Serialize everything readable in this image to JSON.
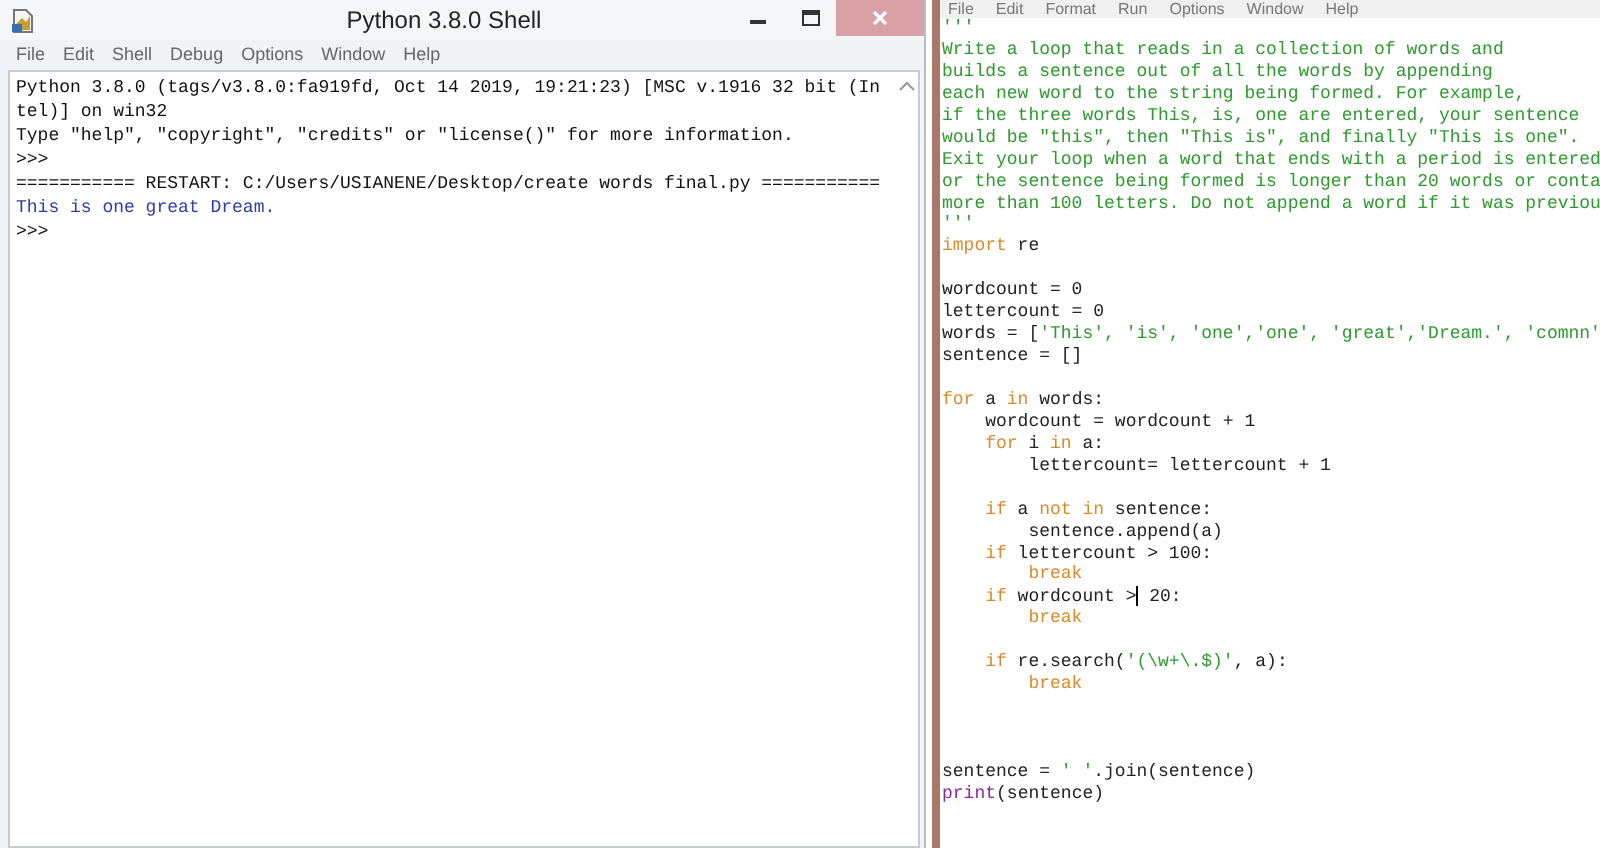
{
  "shell": {
    "title": "Python 3.8.0 Shell",
    "menu": [
      "File",
      "Edit",
      "Shell",
      "Debug",
      "Options",
      "Window",
      "Help"
    ],
    "lines": [
      {
        "kind": "plain",
        "text": "Python 3.8.0 (tags/v3.8.0:fa919fd, Oct 14 2019, 19:21:23) [MSC v.1916 32 bit (In"
      },
      {
        "kind": "plain",
        "text": "tel)] on win32"
      },
      {
        "kind": "plain",
        "text": "Type \"help\", \"copyright\", \"credits\" or \"license()\" for more information."
      },
      {
        "kind": "prompt",
        "text": ">>>"
      },
      {
        "kind": "plain",
        "text": "=========== RESTART: C:/Users/USIANENE/Desktop/create words final.py ==========="
      },
      {
        "kind": "output",
        "text": "This is one great Dream."
      },
      {
        "kind": "prompt",
        "text": ">>>"
      }
    ]
  },
  "editor": {
    "menu": [
      "File",
      "Edit",
      "Format",
      "Run",
      "Options",
      "Window",
      "Help"
    ],
    "lines": [
      {
        "kind": "code",
        "segments": [
          {
            "kind": "string",
            "text": "'''"
          }
        ]
      },
      {
        "kind": "code",
        "segments": [
          {
            "kind": "string",
            "text": "Write a loop that reads in a collection of words and"
          }
        ]
      },
      {
        "kind": "code",
        "segments": [
          {
            "kind": "string",
            "text": "builds a sentence out of all the words by appending"
          }
        ]
      },
      {
        "kind": "code",
        "segments": [
          {
            "kind": "string",
            "text": "each new word to the string being formed. For example,"
          }
        ]
      },
      {
        "kind": "code",
        "segments": [
          {
            "kind": "string",
            "text": "if the three words This, is, one are entered, your sentence"
          }
        ]
      },
      {
        "kind": "code",
        "segments": [
          {
            "kind": "string",
            "text": "would be \"this\", then \"This is\", and finally \"This is one\"."
          }
        ]
      },
      {
        "kind": "code",
        "segments": [
          {
            "kind": "string",
            "text": "Exit your loop when a word that ends with a period is entered"
          }
        ]
      },
      {
        "kind": "code",
        "segments": [
          {
            "kind": "string",
            "text": "or the sentence being formed is longer than 20 words or conta"
          }
        ]
      },
      {
        "kind": "code",
        "segments": [
          {
            "kind": "string",
            "text": "more than 100 letters. Do not append a word if it was previou"
          }
        ]
      },
      {
        "kind": "code",
        "segments": [
          {
            "kind": "string",
            "text": "'''"
          }
        ]
      },
      {
        "kind": "code",
        "segments": [
          {
            "kind": "keyword",
            "text": "import"
          },
          {
            "kind": "plain",
            "text": " re"
          }
        ]
      },
      {
        "kind": "blank"
      },
      {
        "kind": "code",
        "segments": [
          {
            "kind": "plain",
            "text": "wordcount = 0"
          }
        ]
      },
      {
        "kind": "code",
        "segments": [
          {
            "kind": "plain",
            "text": "lettercount = 0"
          }
        ]
      },
      {
        "kind": "code",
        "segments": [
          {
            "kind": "plain",
            "text": "words = ["
          },
          {
            "kind": "string",
            "text": "'This', 'is', 'one','one', 'great','Dream.', 'comnn'"
          }
        ]
      },
      {
        "kind": "code",
        "segments": [
          {
            "kind": "plain",
            "text": "sentence = []"
          }
        ]
      },
      {
        "kind": "blank"
      },
      {
        "kind": "code",
        "segments": [
          {
            "kind": "keyword",
            "text": "for"
          },
          {
            "kind": "plain",
            "text": " a "
          },
          {
            "kind": "keyword",
            "text": "in"
          },
          {
            "kind": "plain",
            "text": " words:"
          }
        ]
      },
      {
        "kind": "code",
        "segments": [
          {
            "kind": "plain",
            "text": "    wordcount = wordcount + 1"
          }
        ]
      },
      {
        "kind": "code",
        "segments": [
          {
            "kind": "keyword",
            "text": "    for"
          },
          {
            "kind": "plain",
            "text": " i "
          },
          {
            "kind": "keyword",
            "text": "in"
          },
          {
            "kind": "plain",
            "text": " a:"
          }
        ]
      },
      {
        "kind": "code",
        "segments": [
          {
            "kind": "plain",
            "text": "        lettercount= lettercount + 1"
          }
        ]
      },
      {
        "kind": "blank"
      },
      {
        "kind": "code",
        "segments": [
          {
            "kind": "keyword",
            "text": "    if"
          },
          {
            "kind": "plain",
            "text": " a "
          },
          {
            "kind": "keyword",
            "text": "not in"
          },
          {
            "kind": "plain",
            "text": " sentence:"
          }
        ]
      },
      {
        "kind": "code",
        "segments": [
          {
            "kind": "plain",
            "text": "        sentence.append(a)"
          }
        ]
      },
      {
        "kind": "code",
        "segments": [
          {
            "kind": "keyword",
            "text": "    if"
          },
          {
            "kind": "plain",
            "text": " lettercount > 100:"
          }
        ]
      },
      {
        "kind": "code",
        "segments": [
          {
            "kind": "keyword",
            "text": "        break"
          }
        ]
      },
      {
        "kind": "code",
        "segments": [
          {
            "kind": "keyword",
            "text": "    if"
          },
          {
            "kind": "plain",
            "text": " wordcount >"
          },
          {
            "kind": "cursor"
          },
          {
            "kind": "plain",
            "text": " 20:"
          }
        ]
      },
      {
        "kind": "code",
        "segments": [
          {
            "kind": "keyword",
            "text": "        break"
          }
        ]
      },
      {
        "kind": "blank"
      },
      {
        "kind": "code",
        "segments": [
          {
            "kind": "keyword",
            "text": "    if"
          },
          {
            "kind": "plain",
            "text": " re.search("
          },
          {
            "kind": "string",
            "text": "'(\\w+\\.$)'"
          },
          {
            "kind": "plain",
            "text": ", a):"
          }
        ]
      },
      {
        "kind": "code",
        "segments": [
          {
            "kind": "keyword",
            "text": "        break"
          }
        ]
      },
      {
        "kind": "blank"
      },
      {
        "kind": "blank"
      },
      {
        "kind": "blank"
      },
      {
        "kind": "code",
        "segments": [
          {
            "kind": "plain",
            "text": "sentence = "
          },
          {
            "kind": "string",
            "text": "' '"
          },
          {
            "kind": "plain",
            "text": ".join(sentence)"
          }
        ]
      },
      {
        "kind": "code",
        "segments": [
          {
            "kind": "builtin",
            "text": "print"
          },
          {
            "kind": "plain",
            "text": "(sentence)"
          }
        ]
      }
    ]
  }
}
